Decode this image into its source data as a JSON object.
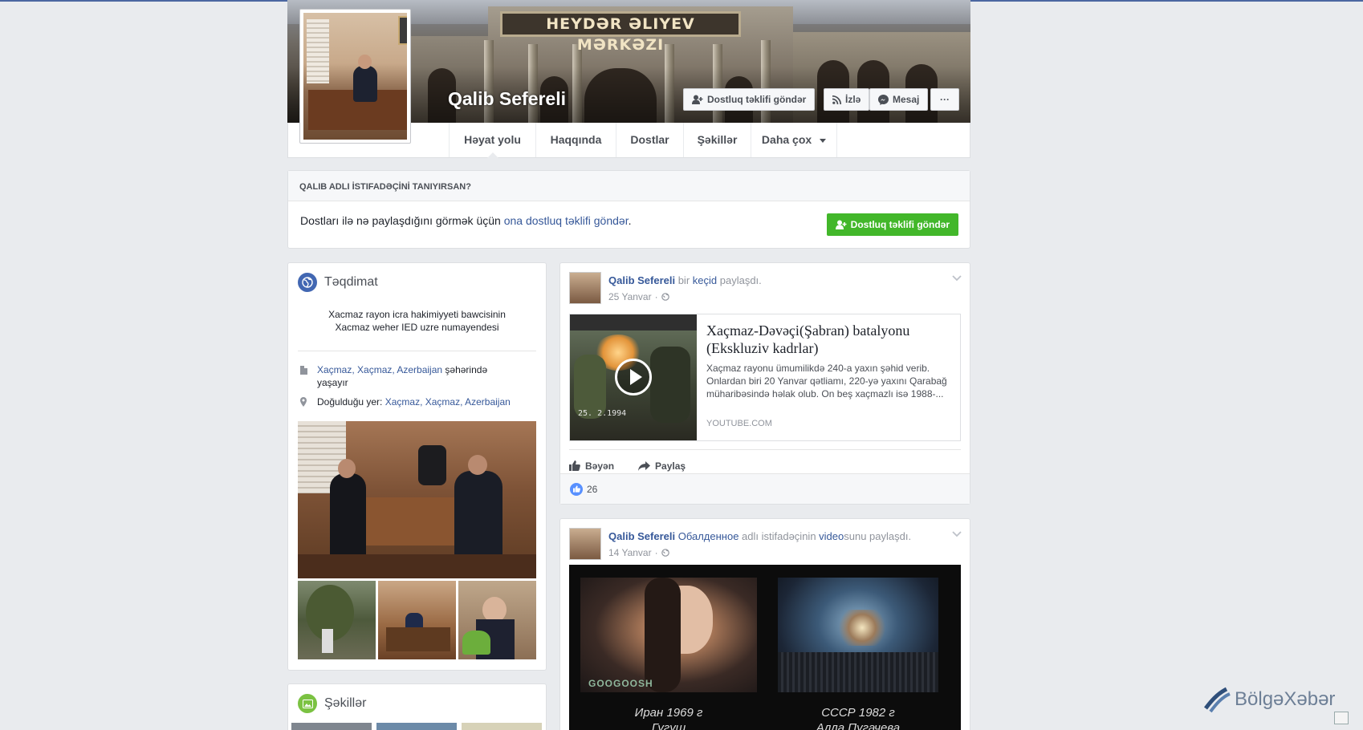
{
  "cover": {
    "sign_text": "HEYDƏR ƏLIYEV MƏRKƏZI",
    "profile_name": "Qalib Sefereli",
    "buttons": {
      "add_friend": "Dostluq təklifi göndər",
      "follow": "İzlə",
      "message": "Mesaj",
      "more": "···"
    }
  },
  "tabs": [
    "Həyat yolu",
    "Haqqında",
    "Dostlar",
    "Şəkillər",
    "Daha çox"
  ],
  "know_box": {
    "header": "QALIB ADLI İSTIFADƏÇİNİ TANIYIRSAN?",
    "text_before": "Dostları ilə nə paylaşdığını görmək üçün ",
    "link": "ona dostluq təklifi göndər",
    "text_after": ".",
    "button": "Dostluq təklifi göndər"
  },
  "intro": {
    "title": "Təqdimat",
    "bio_line1": "Xacmaz rayon icra hakimiyyeti bawcisinin",
    "bio_line2": "Xacmaz weher IED uzre numayendesi",
    "lives_link": "Xaçmaz, Xaçmaz, Azerbaijan",
    "lives_suffix": " şəhərində yaşayır",
    "born_prefix": "Doğulduğu yer: ",
    "born_link": "Xaçmaz, Xaçmaz, Azerbaijan"
  },
  "photos_card": {
    "title": "Şəkillər"
  },
  "post1": {
    "author": "Qalib Sefereli",
    "verb1": " bir ",
    "object": "keçid",
    "verb2": " paylaşdı.",
    "date": "25 Yanvar",
    "link_title": "Xaçmaz-Dəvəçi(Şabran) batalyonu (Ekskluziv kadrlar)",
    "link_desc": "Xaçmaz rayonu ümumilikdə 240-a yaxın şəhid verib. Onlardan biri 20 Yanvar qətliamı, 220-yə yaxını Qarabağ müharibəsində həlak olub. On beş xaçmazlı isə 1988-...",
    "link_source": "YOUTUBE.COM",
    "video_stamp": "25. 2.1994",
    "like_label": "Bəyən",
    "share_label": "Paylaş",
    "likes_count": "26"
  },
  "post2": {
    "author": "Qalib Sefereli",
    "shared_from": "Обалденное",
    "mid_text": " adlı istifadəçinin ",
    "object": "video",
    "end_text": "sunu paylaşdı.",
    "date": "14 Yanvar",
    "tv_logo": "GOOGOOSH",
    "cap1_line1": "Иран 1969 г",
    "cap1_line2": "Гугуш",
    "cap2_line1": "СССР 1982 г",
    "cap2_line2": "Алла Пугачева"
  },
  "watermark": {
    "brand": "BölgəXəbər"
  },
  "colors": {
    "fb_blue": "#365899",
    "green": "#42b72a",
    "background": "#e9ebee"
  }
}
